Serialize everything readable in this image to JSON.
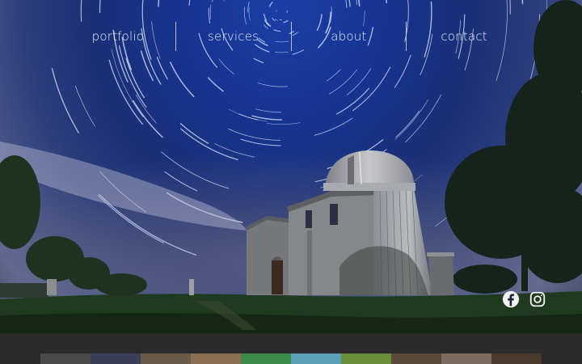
{
  "nav": {
    "items": [
      {
        "label": "portfolio"
      },
      {
        "label": "services"
      },
      {
        "label": "about"
      },
      {
        "label": "contact"
      }
    ]
  },
  "social": {
    "facebook_icon": "facebook-icon",
    "instagram_icon": "instagram-icon"
  },
  "colors": {
    "sky_top": "#1a3fa8",
    "nav_text": "#e8ecf6",
    "footer_bg": "#2b2b2b",
    "grass": "#1f3a1f"
  },
  "thumbnails": [
    {
      "color": "#4a4a4a"
    },
    {
      "color": "#3a3f57"
    },
    {
      "color": "#6b5a48"
    },
    {
      "color": "#8a6f52"
    },
    {
      "color": "#3e8a4d"
    },
    {
      "color": "#5aa0b8"
    },
    {
      "color": "#6a8f3a"
    },
    {
      "color": "#5b4a3a"
    },
    {
      "color": "#7a6d60"
    },
    {
      "color": "#4a3a2e"
    }
  ]
}
